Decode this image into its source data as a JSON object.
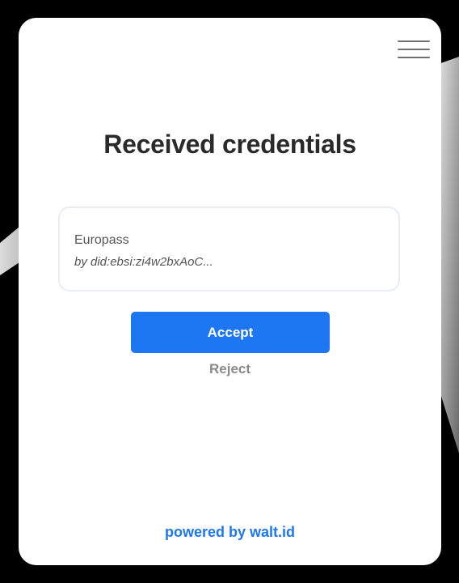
{
  "header": {
    "menu_icon": "hamburger-menu-icon"
  },
  "main": {
    "title": "Received credentials",
    "credential": {
      "name": "Europass",
      "issuer": "by did:ebsi:zi4w2bxAoC..."
    },
    "accept_label": "Accept",
    "reject_label": "Reject"
  },
  "footer": {
    "powered_by": "powered by walt.id"
  },
  "colors": {
    "accent": "#1d76f2",
    "title": "#2a2a2a",
    "muted": "#8a8a8a",
    "card_border": "#e9ecf7"
  }
}
